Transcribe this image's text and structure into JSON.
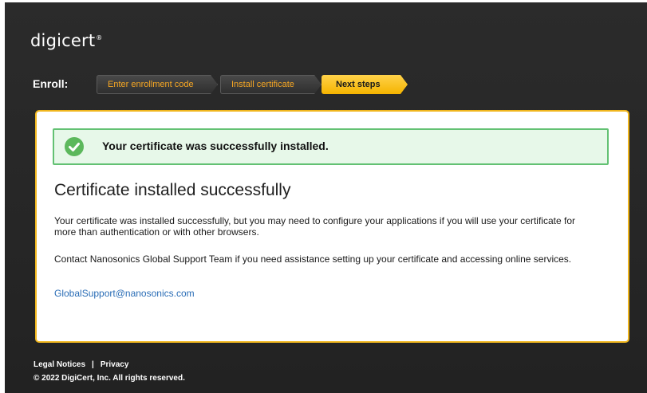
{
  "brand": {
    "logo_text": "digicert",
    "logo_mark": "®"
  },
  "enroll": {
    "label": "Enroll:",
    "steps": [
      {
        "label": "Enter enrollment code",
        "state": "done"
      },
      {
        "label": "Install certificate",
        "state": "done"
      },
      {
        "label": "Next steps",
        "state": "current"
      }
    ]
  },
  "alert": {
    "message": "Your certificate was successfully installed.",
    "icon": "check-circle-icon",
    "color": "#5cb85c"
  },
  "content": {
    "title": "Certificate installed successfully",
    "paragraph1": "Your certificate was installed successfully, but you may need to configure your applications if you will use your certificate for more than authentication or with other browsers.",
    "paragraph2": "Contact Nanosonics Global Support Team if you need assistance setting up your certificate and accessing online services.",
    "email": "GlobalSupport@nanosonics.com"
  },
  "footer": {
    "legal_label": "Legal Notices",
    "separator": "|",
    "privacy_label": "Privacy",
    "copyright": "© 2022 DigiCert, Inc. All rights reserved."
  },
  "colors": {
    "accent": "#f0b61d",
    "link": "#2a6db6",
    "success_border": "#63c173"
  }
}
